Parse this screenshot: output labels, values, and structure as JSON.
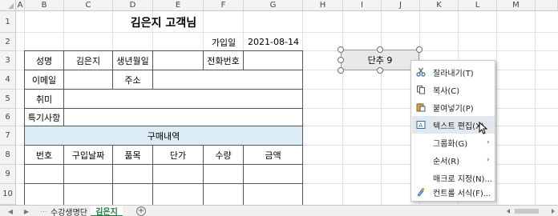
{
  "columns": [
    "A",
    "B",
    "C",
    "D",
    "E",
    "F",
    "G",
    "H",
    "I",
    "J",
    "K",
    "L",
    "M"
  ],
  "rows": [
    "1",
    "2",
    "3",
    "4",
    "5",
    "6",
    "7",
    "8",
    "9",
    "10"
  ],
  "sheet": {
    "title": "김은지 고객님",
    "join_label": "가입일",
    "join_date": "2021-08-14",
    "name_label": "성명",
    "name_value": "김은지",
    "birthday_label": "생년월일",
    "phone_label": "전화번호",
    "email_label": "이메일",
    "address_label": "주소",
    "hobby_label": "취미",
    "notes_label": "특기사항",
    "purchase_header": "구매내역",
    "table_headers": [
      "번호",
      "구입날짜",
      "품목",
      "단가",
      "수량",
      "금액"
    ]
  },
  "shape": {
    "label": "단추 9"
  },
  "context_menu": {
    "items": [
      {
        "label": "잘라내기(T)",
        "icon": "scissors-icon"
      },
      {
        "label": "복사(C)",
        "icon": "copy-icon"
      },
      {
        "label": "붙여넣기(P)",
        "icon": "paste-icon"
      },
      {
        "label": "텍스트 편집(X)",
        "icon": "edit-text-icon",
        "highlighted": true
      },
      {
        "label": "그룹화(G)",
        "icon": "",
        "submenu": true
      },
      {
        "label": "순서(R)",
        "icon": "",
        "submenu": true
      },
      {
        "label": "매크로 지정(N)...",
        "icon": ""
      },
      {
        "label": "컨트롤 서식(F)...",
        "icon": "format-control-icon"
      }
    ]
  },
  "tabs": [
    "수강생명단",
    "김은지"
  ],
  "active_tab": "김은지",
  "colors": {
    "accent_green": "#1f7a44",
    "header_teal": "#dcecf4",
    "menu_highlight": "#e3e8ef"
  }
}
